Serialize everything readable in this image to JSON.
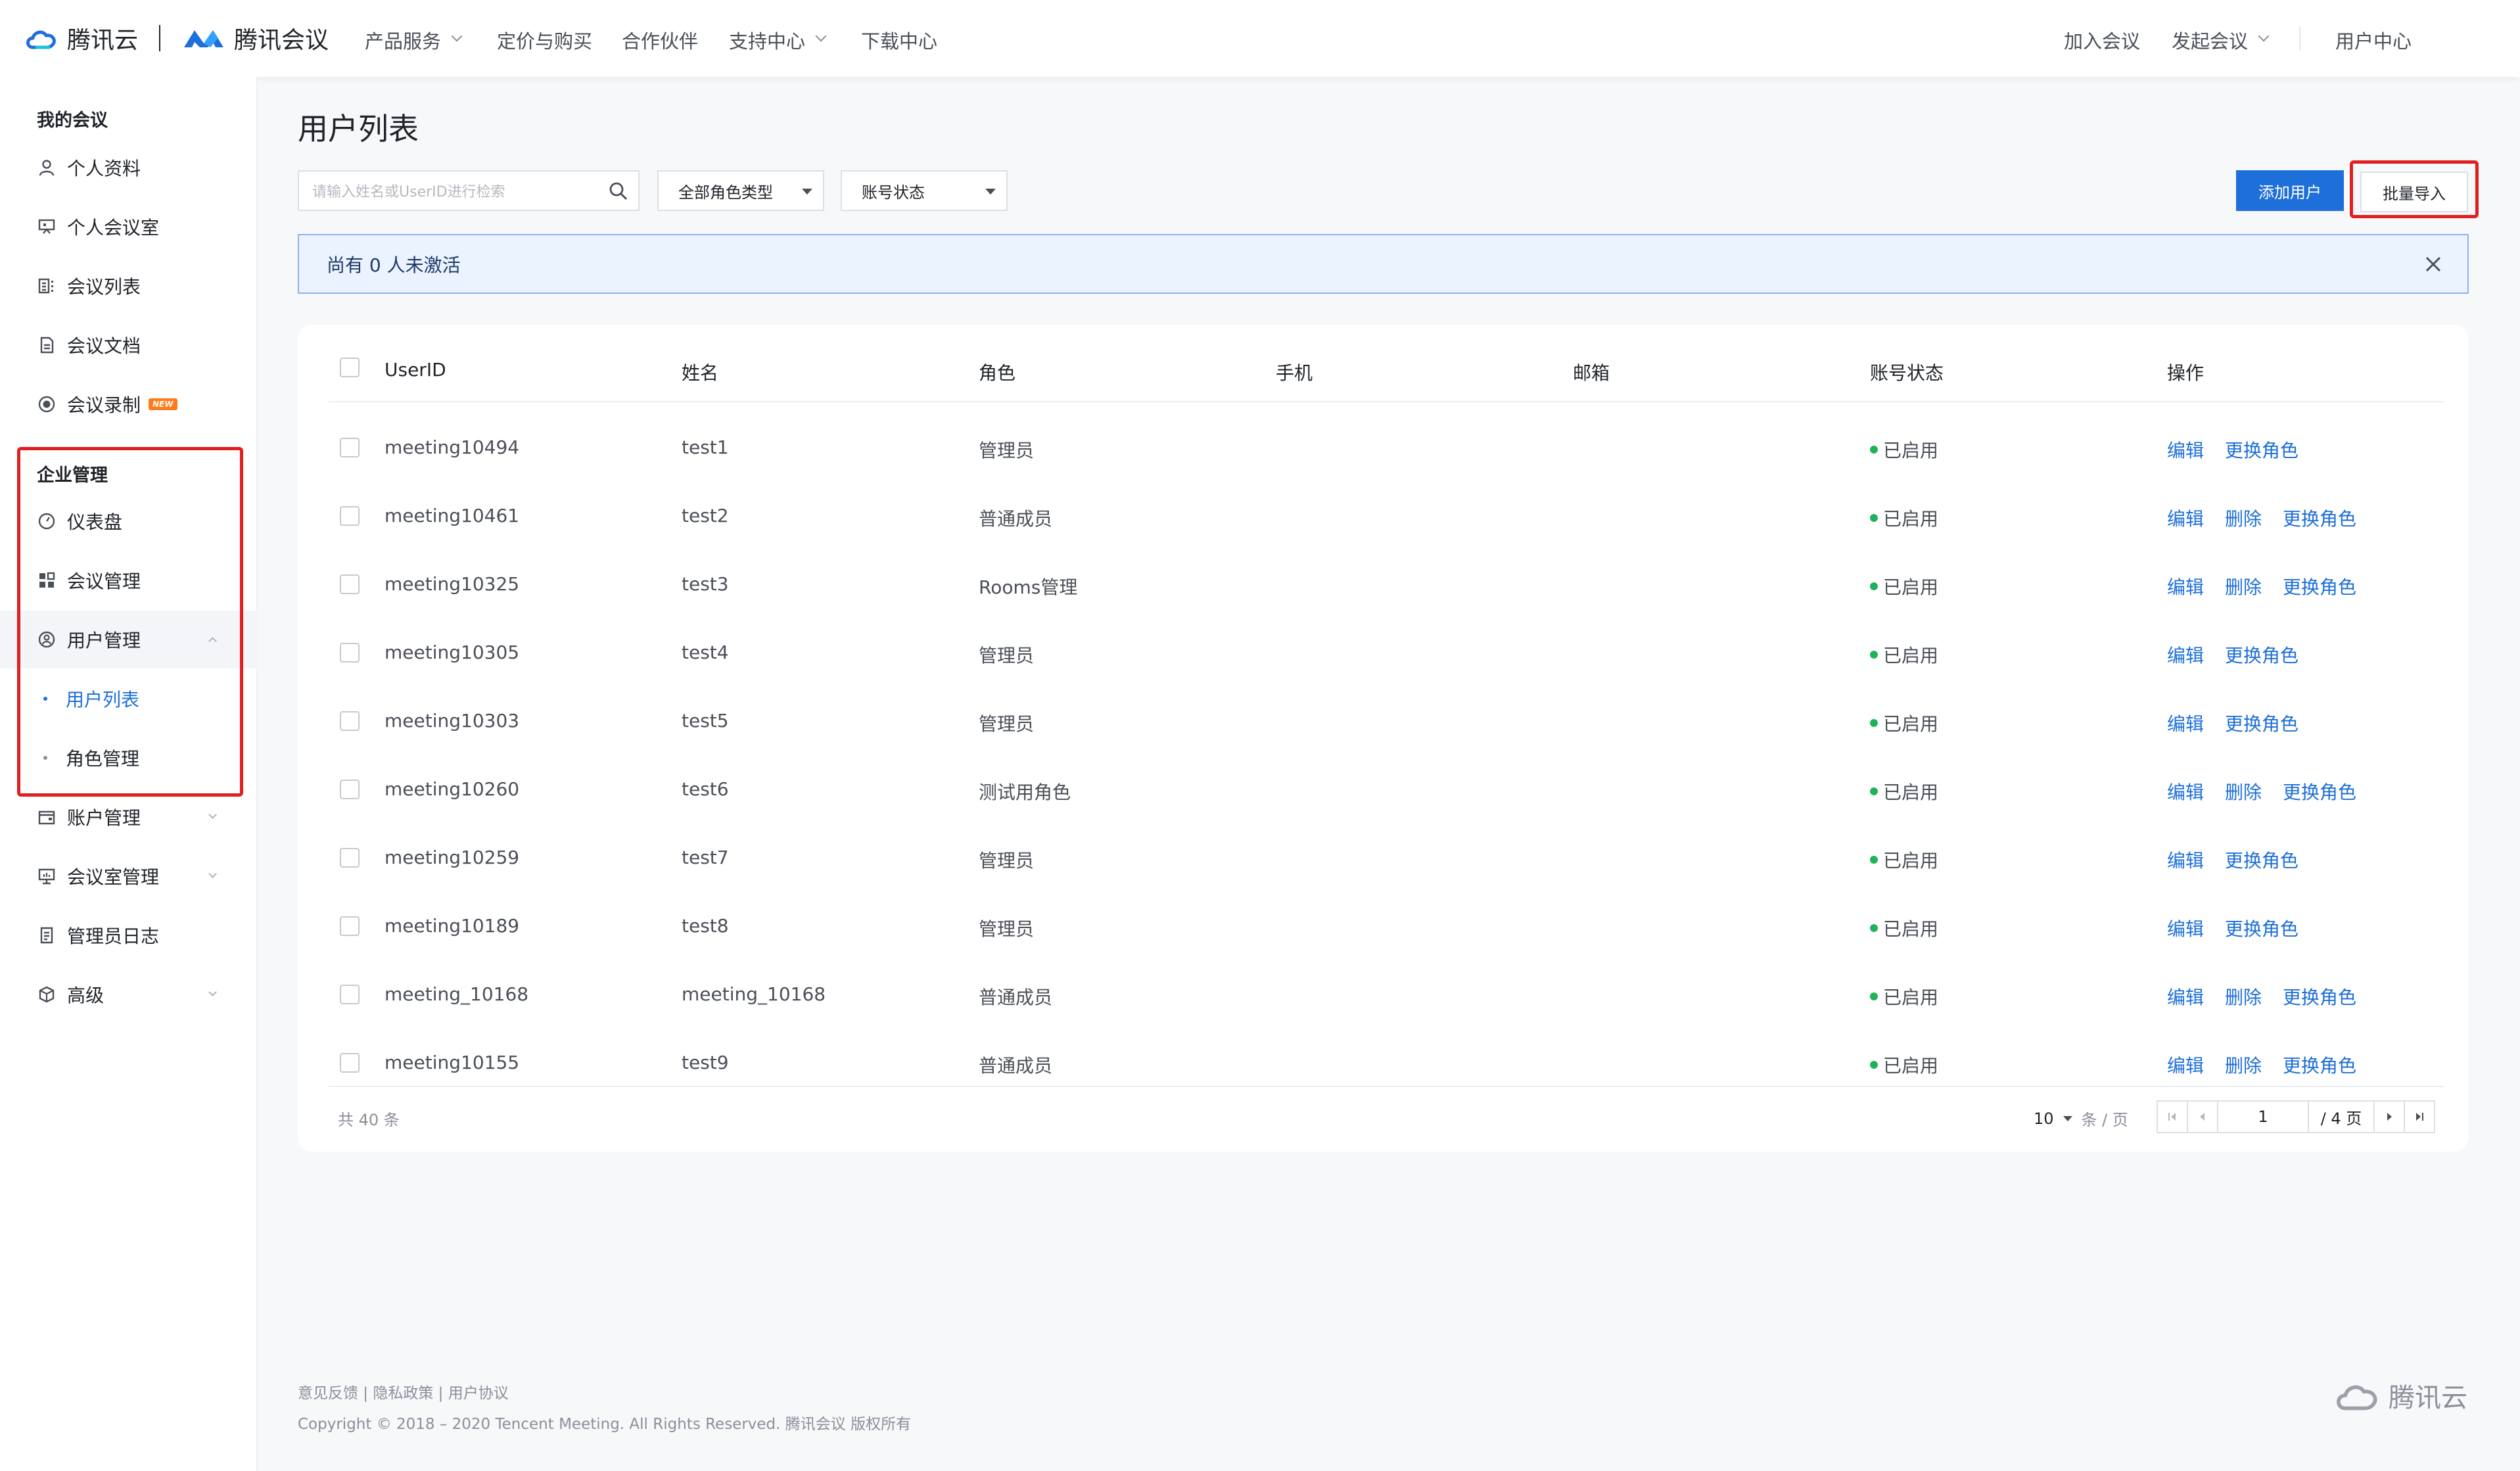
{
  "header": {
    "brand1": "腾讯云",
    "brand2": "腾讯会议",
    "nav": [
      {
        "label": "产品服务",
        "dropdown": true
      },
      {
        "label": "定价与购买",
        "dropdown": false
      },
      {
        "label": "合作伙伴",
        "dropdown": false
      },
      {
        "label": "支持中心",
        "dropdown": true
      },
      {
        "label": "下载中心",
        "dropdown": false
      }
    ],
    "right_nav": {
      "join": "加入会议",
      "start": "发起会议",
      "user_center": "用户中心"
    }
  },
  "sidebar": {
    "section_my": "我的会议",
    "my_items": [
      {
        "label": "个人资料",
        "icon": "user-icon"
      },
      {
        "label": "个人会议室",
        "icon": "meeting-room-icon"
      },
      {
        "label": "会议列表",
        "icon": "list-icon"
      },
      {
        "label": "会议文档",
        "icon": "document-icon"
      },
      {
        "label": "会议录制",
        "icon": "record-icon",
        "badge": "NEW"
      }
    ],
    "section_enterprise": "企业管理",
    "enterprise_items": [
      {
        "label": "仪表盘",
        "icon": "dashboard-icon"
      },
      {
        "label": "会议管理",
        "icon": "grid-icon"
      },
      {
        "label": "用户管理",
        "icon": "user-manage-icon",
        "expanded": true
      }
    ],
    "sub_items": [
      {
        "label": "用户列表",
        "current": true
      },
      {
        "label": "角色管理",
        "current": false
      }
    ],
    "more_items": [
      {
        "label": "账户管理",
        "icon": "account-icon",
        "dropdown": true
      },
      {
        "label": "会议室管理",
        "icon": "room-manage-icon",
        "dropdown": true
      },
      {
        "label": "管理员日志",
        "icon": "log-icon",
        "dropdown": false
      },
      {
        "label": "高级",
        "icon": "advanced-icon",
        "dropdown": true
      }
    ]
  },
  "main": {
    "title": "用户列表",
    "search_placeholder": "请输入姓名或UserID进行检索",
    "filter_role": "全部角色类型",
    "filter_status": "账号状态",
    "add_user": "添加用户",
    "batch_import": "批量导入",
    "alert_text": "尚有 0 人未激活",
    "columns": [
      "UserID",
      "姓名",
      "角色",
      "手机",
      "邮箱",
      "账号状态",
      "操作"
    ],
    "rows": [
      {
        "userid": "meeting10494",
        "name": "test1",
        "role": "管理员",
        "status": "已启用",
        "actions": [
          "编辑",
          "更换角色"
        ]
      },
      {
        "userid": "meeting10461",
        "name": "test2",
        "role": "普通成员",
        "status": "已启用",
        "actions": [
          "编辑",
          "删除",
          "更换角色"
        ]
      },
      {
        "userid": "meeting10325",
        "name": "test3",
        "role": "Rooms管理",
        "status": "已启用",
        "actions": [
          "编辑",
          "删除",
          "更换角色"
        ]
      },
      {
        "userid": "meeting10305",
        "name": "test4",
        "role": "管理员",
        "status": "已启用",
        "actions": [
          "编辑",
          "更换角色"
        ]
      },
      {
        "userid": "meeting10303",
        "name": "test5",
        "role": "管理员",
        "status": "已启用",
        "actions": [
          "编辑",
          "更换角色"
        ]
      },
      {
        "userid": "meeting10260",
        "name": "test6",
        "role": "测试用角色",
        "status": "已启用",
        "actions": [
          "编辑",
          "删除",
          "更换角色"
        ]
      },
      {
        "userid": "meeting10259",
        "name": "test7",
        "role": "管理员",
        "status": "已启用",
        "actions": [
          "编辑",
          "更换角色"
        ]
      },
      {
        "userid": "meeting10189",
        "name": "test8",
        "role": "管理员",
        "status": "已启用",
        "actions": [
          "编辑",
          "更换角色"
        ]
      },
      {
        "userid": "meeting_10168",
        "name": "meeting_10168",
        "role": "普通成员",
        "status": "已启用",
        "actions": [
          "编辑",
          "删除",
          "更换角色"
        ]
      },
      {
        "userid": "meeting10155",
        "name": "test9",
        "role": "普通成员",
        "status": "已启用",
        "actions": [
          "编辑",
          "删除",
          "更换角色"
        ]
      }
    ],
    "total_text": "共 40 条",
    "page_size": "10",
    "page_size_unit": "条 / 页",
    "current_page": "1",
    "total_pages_text": "/ 4 页"
  },
  "footer": {
    "links": "意见反馈 | 隐私政策 | 用户协议",
    "copyright": "Copyright © 2018 – 2020 Tencent Meeting. All Rights Reserved. 腾讯会议 版权所有",
    "logo_text": "腾讯云"
  },
  "colors": {
    "primary": "#1e6fd9",
    "highlight": "#e02020",
    "status_ok": "#20b25a"
  }
}
